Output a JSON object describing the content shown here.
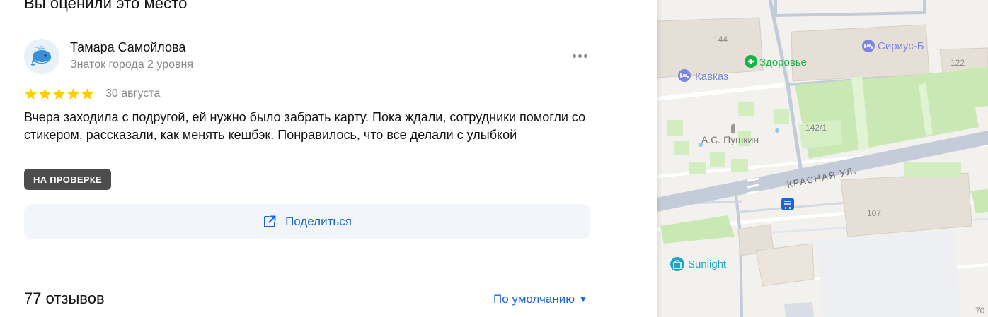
{
  "heading": "Вы оценили это место",
  "review": {
    "author_name": "Тамара Самойлова",
    "author_level": "Знаток города 2 уровня",
    "rating": 5,
    "date": "30 августа",
    "text": "Вчера заходила с подругой, ей нужно было забрать карту. Пока ждали, сотрудники помогли со стикером, рассказали, как менять кешбэк. Понравилось, что все делали с улыбкой",
    "status_badge": "НА ПРОВЕРКЕ",
    "share_label": "Поделиться",
    "icons": {
      "avatar": "whale-avatar-icon",
      "more": "more-dots-icon",
      "share": "share-icon",
      "star": "star-icon"
    },
    "colors": {
      "star": "#fc0",
      "accent": "#1b63d8",
      "badge_bg": "#4d4d4d"
    }
  },
  "reviews_section": {
    "count_label": "77 отзывов",
    "sort_label": "По умолчанию",
    "sort_arrow": "▼"
  },
  "map": {
    "labels": {
      "b144": "144",
      "b122": "122",
      "b1421": "142/1",
      "b107": "107",
      "zdorovye": "Здоровье",
      "sirius": "Сириус-Б",
      "kavkaz": "Кавказ",
      "pushkin": "А.С. Пушкин",
      "street": "КРАСНАЯ УЛ.",
      "sunlight": "Sunlight",
      "b70": "70"
    },
    "colors": {
      "pharmacy": "#19b34a",
      "hotel": "#7c86e0",
      "shop": "#1fa4c4",
      "transit": "#1b63d8"
    }
  }
}
